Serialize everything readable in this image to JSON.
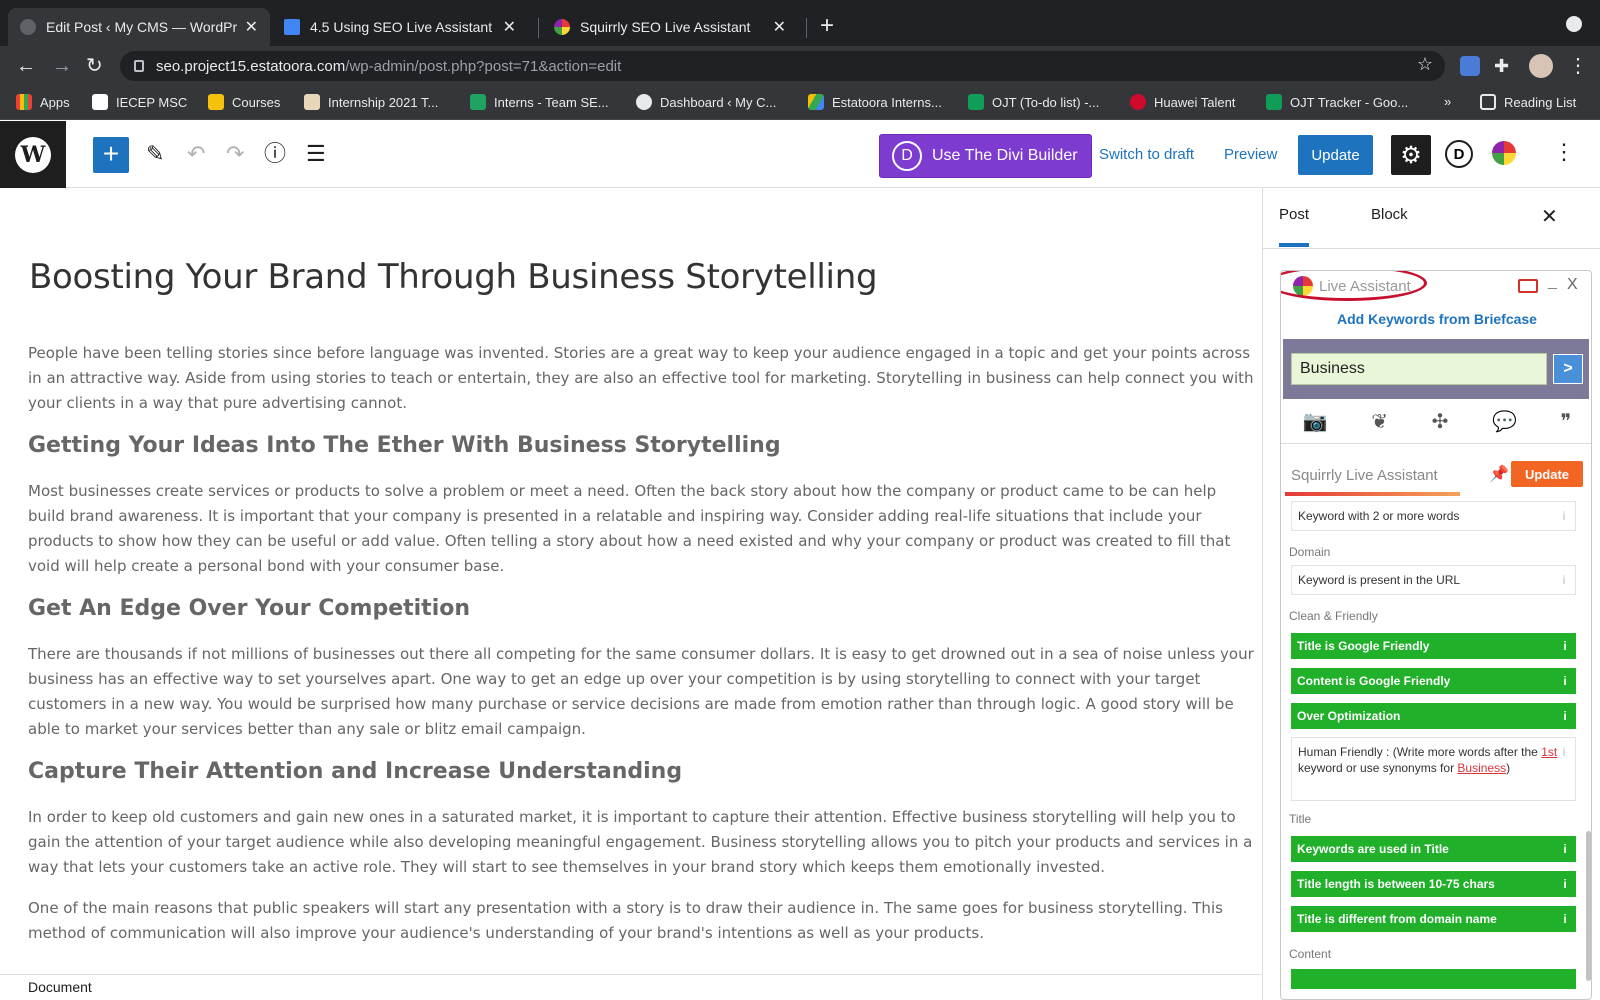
{
  "browser": {
    "tabs": [
      {
        "title": "Edit Post ‹ My CMS — WordPre",
        "close": "✕"
      },
      {
        "title": "4.5 Using SEO Live Assistant -",
        "close": "✕"
      },
      {
        "title": "Squirrly SEO Live Assistant",
        "close": "✕"
      }
    ],
    "new_tab": "+",
    "address_host": "seo.project15.estatoora.com",
    "address_path": "/wp-admin/post.php?post=71&action=edit",
    "bookmarks": [
      "Apps",
      "IECEP MSC",
      "Courses",
      "Internship 2021 T...",
      "Interns - Team SE...",
      "Dashboard ‹ My C...",
      "Estatoora Interns...",
      "OJT (To-do list) -...",
      "Huawei Talent",
      "OJT Tracker - Goo...",
      "»",
      "Reading List"
    ]
  },
  "toolbar": {
    "divi_letter": "D",
    "divi_label": "Use The Divi Builder",
    "switch_draft": "Switch to draft",
    "preview": "Preview",
    "update": "Update",
    "d_letter": "D"
  },
  "post": {
    "title": "Boosting Your Brand Through Business Storytelling",
    "p1": "People have been telling stories since before language was invented. Stories are a great way to keep your audience engaged in a topic and get your points across in an attractive way. Aside from using stories to teach or entertain, they are also an effective tool for marketing. Storytelling in business can help connect you with your clients in a way that pure advertising cannot.",
    "h2_1": "Getting Your Ideas Into The Ether With Business Storytelling",
    "p2": "Most businesses create services or products to solve a problem or meet a need. Often the back story about how the company or product came to be can help build brand awareness. It is important that your company is presented in a relatable and inspiring way. Consider adding real-life situations that include your products to show how they can be useful or add value. Often telling a story about how a need existed and why your company or product was created to fill that void will help create a personal bond with your consumer base.",
    "h2_2": "Get An Edge Over Your Competition",
    "p3": "There are thousands if not millions of businesses out there all competing for the same consumer dollars. It is easy to get drowned out in a sea of noise unless your business has an effective way to set yourselves apart. One way to get an edge up over your competition is by using storytelling to connect with your target customers in a new way. You would be surprised how many purchase or service decisions are made from emotion rather than through logic. A good story will be able to market your services better than any sale or blitz email campaign.",
    "h2_3": "Capture Their Attention and Increase Understanding",
    "p4": "In order to keep old customers and gain new ones in a saturated market, it is important to capture their attention. Effective business storytelling will help you to gain the attention of your target audience while also developing meaningful engagement. Business storytelling allows you to pitch your products and services in a way that lets your customers take an active role. They will start to see themselves in your brand story which keeps them emotionally invested.",
    "p5": "One of the main reasons that public speakers will start any presentation with a story is to draw their audience in. The same goes for business storytelling. This method of communication will also improve your audience's understanding of your brand's intentions as well as your products."
  },
  "statusbar": "Document",
  "sidebar": {
    "tab_post": "Post",
    "tab_block": "Block",
    "close": "✕"
  },
  "assistant": {
    "title": "Live Assistant",
    "min": "_",
    "close": "X",
    "add_keywords": "Add Keywords from Briefcase",
    "keyword": "Business",
    "go": ">",
    "squirrly_title": "Squirrly Live Assistant",
    "update": "Update",
    "rows": {
      "r1": "Keyword with 2 or more words",
      "sec_domain": "Domain",
      "r2": "Keyword is present in the URL",
      "sec_clean": "Clean & Friendly",
      "r3": "Title is Google Friendly",
      "r4": "Content is Google Friendly",
      "r5": "Over Optimization",
      "r6_a": "Human Friendly : (Write more words after the ",
      "r6_link1": "1st",
      "r6_b": " keyword or use synonyms for ",
      "r6_link2": "Business",
      "r6_c": ")",
      "sec_title": "Title",
      "r7": "Keywords are used in Title",
      "r8": "Title length is between 10-75 chars",
      "r9": "Title is different from domain name",
      "sec_content": "Content"
    }
  }
}
